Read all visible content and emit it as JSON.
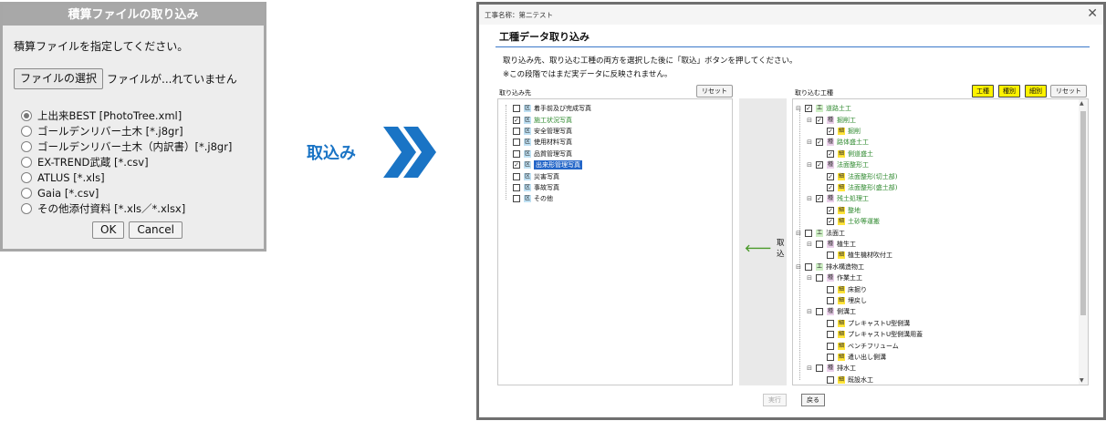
{
  "import_dialog": {
    "title": "積算ファイルの取り込み",
    "prompt": "積算ファイルを指定してください。",
    "file_button": "ファイルの選択",
    "file_status": "ファイルが...れていません",
    "options": [
      {
        "label": "上出来BEST [PhotoTree.xml]",
        "checked": true
      },
      {
        "label": "ゴールデンリバー土木 [*.j8gr]",
        "checked": false
      },
      {
        "label": "ゴールデンリバー土木（内訳書）[*.j8gr]",
        "checked": false
      },
      {
        "label": "EX-TREND武蔵 [*.csv]",
        "checked": false
      },
      {
        "label": "ATLUS [*.xls]",
        "checked": false
      },
      {
        "label": "Gaia [*.csv]",
        "checked": false
      },
      {
        "label": "その他添付資料 [*.xls／*.xlsx]",
        "checked": false
      }
    ],
    "ok": "OK",
    "cancel": "Cancel"
  },
  "arrow_label": "取込み",
  "colors": {
    "accent": "#1a74c5",
    "selected": "#2466c8",
    "yellow": "#fff200"
  },
  "window": {
    "title": "工事名称：第二テスト",
    "heading": "工種データ取り込み",
    "instruction1": "取り込み先、取り込む工種の両方を選択した後に「取込」ボタンを押してください。",
    "instruction2": "※この段階ではまだ実データに反映されません。",
    "dest_label": "取り込み先",
    "dest_reset": "リセット",
    "src_label": "取り込む工種",
    "btn_kosyu": "工種",
    "btn_syubetsu": "種別",
    "btn_saibetsu": "細別",
    "src_reset": "リセット",
    "take_button": "取込",
    "run_button": "実行",
    "back_button": "戻る",
    "dest_items": [
      {
        "tag": "区",
        "label": "着手前及び完成写真",
        "checked": false,
        "state": "normal"
      },
      {
        "tag": "区",
        "label": "施工状況写真",
        "checked": true,
        "state": "green"
      },
      {
        "tag": "区",
        "label": "安全管理写真",
        "checked": false,
        "state": "normal"
      },
      {
        "tag": "区",
        "label": "使用材料写真",
        "checked": false,
        "state": "normal"
      },
      {
        "tag": "区",
        "label": "品質管理写真",
        "checked": false,
        "state": "normal"
      },
      {
        "tag": "区",
        "label": "出来形管理写真",
        "checked": true,
        "state": "selected"
      },
      {
        "tag": "区",
        "label": "災害写真",
        "checked": false,
        "state": "normal"
      },
      {
        "tag": "区",
        "label": "事故写真",
        "checked": false,
        "state": "normal"
      },
      {
        "tag": "区",
        "label": "その他",
        "checked": false,
        "state": "normal"
      }
    ],
    "src_items": [
      {
        "level": 0,
        "toggle": "⊟",
        "tag": "工",
        "label": "道路土工",
        "checked": true,
        "green": true
      },
      {
        "level": 1,
        "toggle": "⊟",
        "tag": "種",
        "label": "掘削工",
        "checked": true,
        "green": true
      },
      {
        "level": 2,
        "toggle": "",
        "tag": "細",
        "label": "掘削",
        "checked": true,
        "green": true
      },
      {
        "level": 1,
        "toggle": "⊟",
        "tag": "種",
        "label": "路体盛土工",
        "checked": true,
        "green": true
      },
      {
        "level": 2,
        "toggle": "",
        "tag": "細",
        "label": "側道盛土",
        "checked": true,
        "green": true
      },
      {
        "level": 1,
        "toggle": "⊟",
        "tag": "種",
        "label": "法面整形工",
        "checked": true,
        "green": true
      },
      {
        "level": 2,
        "toggle": "",
        "tag": "細",
        "label": "法面整形(切土部)",
        "checked": true,
        "green": true
      },
      {
        "level": 2,
        "toggle": "",
        "tag": "細",
        "label": "法面整形(盛土部)",
        "checked": true,
        "green": true
      },
      {
        "level": 1,
        "toggle": "⊟",
        "tag": "種",
        "label": "残土処理工",
        "checked": true,
        "green": true
      },
      {
        "level": 2,
        "toggle": "",
        "tag": "細",
        "label": "整地",
        "checked": true,
        "green": true
      },
      {
        "level": 2,
        "toggle": "",
        "tag": "細",
        "label": "土砂等運搬",
        "checked": true,
        "green": true
      },
      {
        "level": 0,
        "toggle": "⊟",
        "tag": "工",
        "label": "法面工",
        "checked": false,
        "green": false
      },
      {
        "level": 1,
        "toggle": "⊟",
        "tag": "種",
        "label": "植生工",
        "checked": false,
        "green": false
      },
      {
        "level": 2,
        "toggle": "",
        "tag": "細",
        "label": "植生機材吹付工",
        "checked": false,
        "green": false
      },
      {
        "level": 0,
        "toggle": "⊟",
        "tag": "工",
        "label": "排水構造物工",
        "checked": false,
        "green": false
      },
      {
        "level": 1,
        "toggle": "⊟",
        "tag": "種",
        "label": "作業土工",
        "checked": false,
        "green": false
      },
      {
        "level": 2,
        "toggle": "",
        "tag": "細",
        "label": "床掘り",
        "checked": false,
        "green": false
      },
      {
        "level": 2,
        "toggle": "",
        "tag": "細",
        "label": "埋戻し",
        "checked": false,
        "green": false
      },
      {
        "level": 1,
        "toggle": "⊟",
        "tag": "種",
        "label": "側溝工",
        "checked": false,
        "green": false
      },
      {
        "level": 2,
        "toggle": "",
        "tag": "細",
        "label": "プレキャストU型側溝",
        "checked": false,
        "green": false
      },
      {
        "level": 2,
        "toggle": "",
        "tag": "細",
        "label": "プレキャストU型側溝用蓋",
        "checked": false,
        "green": false
      },
      {
        "level": 2,
        "toggle": "",
        "tag": "細",
        "label": "ベンチフリューム",
        "checked": false,
        "green": false
      },
      {
        "level": 2,
        "toggle": "",
        "tag": "細",
        "label": "遣い出し側溝",
        "checked": false,
        "green": false
      },
      {
        "level": 1,
        "toggle": "⊟",
        "tag": "種",
        "label": "排水工",
        "checked": false,
        "green": false
      },
      {
        "level": 2,
        "toggle": "",
        "tag": "細",
        "label": "既設水工",
        "checked": false,
        "green": false
      }
    ]
  }
}
